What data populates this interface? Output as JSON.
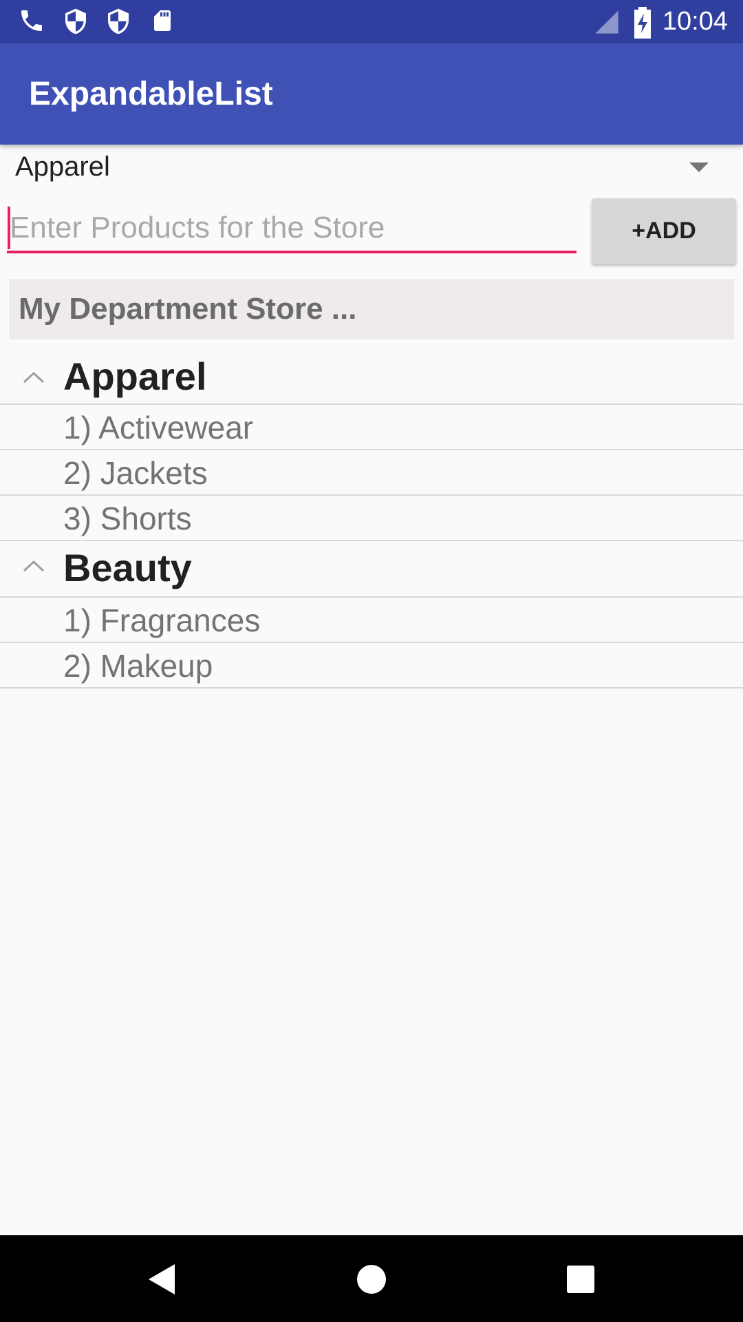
{
  "status_bar": {
    "time": "10:04",
    "icons": [
      "phone-icon",
      "shield-icon",
      "shield-icon",
      "sd-card-icon",
      "signal-icon",
      "battery-charging-icon"
    ]
  },
  "app_bar": {
    "title": "ExpandableList"
  },
  "spinner": {
    "selected": "Apparel"
  },
  "product_input": {
    "value": "",
    "placeholder": "Enter Products for the Store"
  },
  "add_button": {
    "label": "+ADD"
  },
  "store_header": {
    "title": "My Department Store ..."
  },
  "groups": [
    {
      "label": "Apparel",
      "expanded": true,
      "items": [
        "1) Activewear",
        "2) Jackets",
        "3) Shorts"
      ]
    },
    {
      "label": "Beauty",
      "expanded": true,
      "items": [
        "1) Fragrances",
        "2) Makeup"
      ]
    }
  ],
  "nav_bar": {
    "buttons": [
      "back-icon",
      "home-icon",
      "recents-icon"
    ]
  },
  "colors": {
    "status_bar": "#303f9f",
    "app_bar": "#3f51b5",
    "accent": "#e91e63",
    "background": "#fafafa"
  }
}
